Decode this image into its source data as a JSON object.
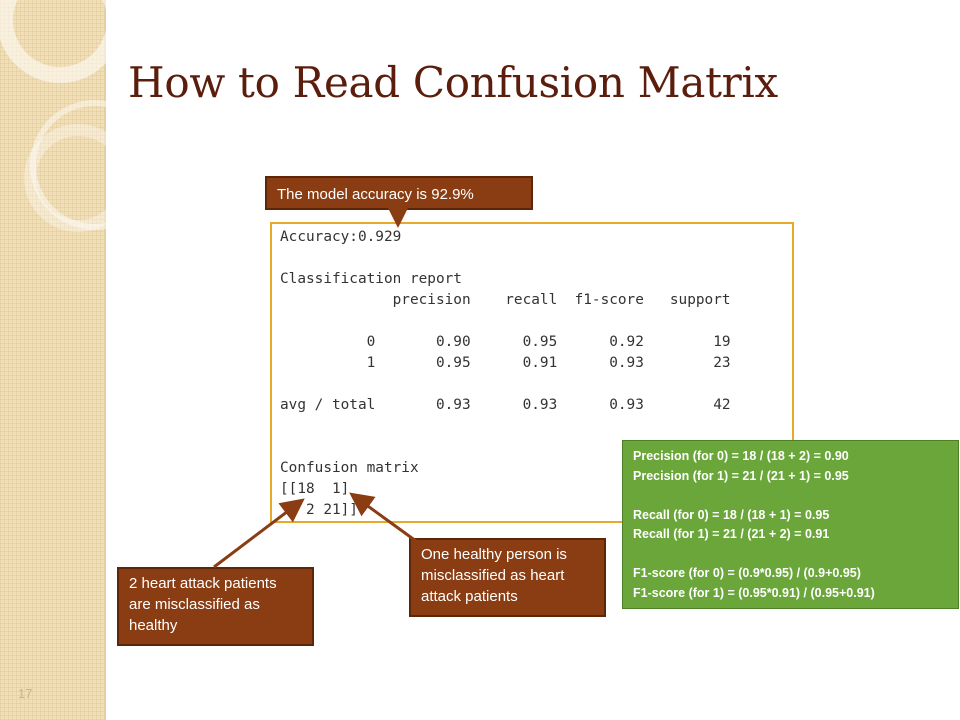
{
  "slide": {
    "title": "How to Read Confusion Matrix",
    "number": "17"
  },
  "callouts": {
    "accuracy": "The model accuracy is 92.9%",
    "false_negatives": "2 heart attack patients are misclassified as healthy",
    "false_positive": "One healthy person is misclassified as heart attack patients"
  },
  "report": {
    "text": "Accuracy:0.929\n\nClassification report\n             precision    recall  f1-score   support\n\n          0       0.90      0.95      0.92        19\n          1       0.95      0.91      0.93        23\n\navg / total       0.93      0.93      0.93        42\n\n\nConfusion matrix\n[[18  1]\n [ 2 21]]"
  },
  "metrics": {
    "precision_0": "Precision (for 0) = 18 / (18 + 2) = 0.90",
    "precision_1": "Precision (for 1) = 21 / (21 + 1) = 0.95",
    "recall_0": "Recall (for 0) = 18 / (18 + 1) = 0.95",
    "recall_1": "Recall (for 1) = 21 / (21 + 2) = 0.91",
    "f1_0": "F1-score (for 0) = (0.9*0.95) / (0.9+0.95)",
    "f1_1": "F1-score (for 1) = (0.95*0.91) / (0.95+0.91)"
  },
  "colors": {
    "title": "#5b1d0c",
    "callout": "#8a3d12",
    "report_border": "#e8a92a",
    "metrics_bg": "#6aa63a",
    "sidebar": "#f1dfb8"
  }
}
